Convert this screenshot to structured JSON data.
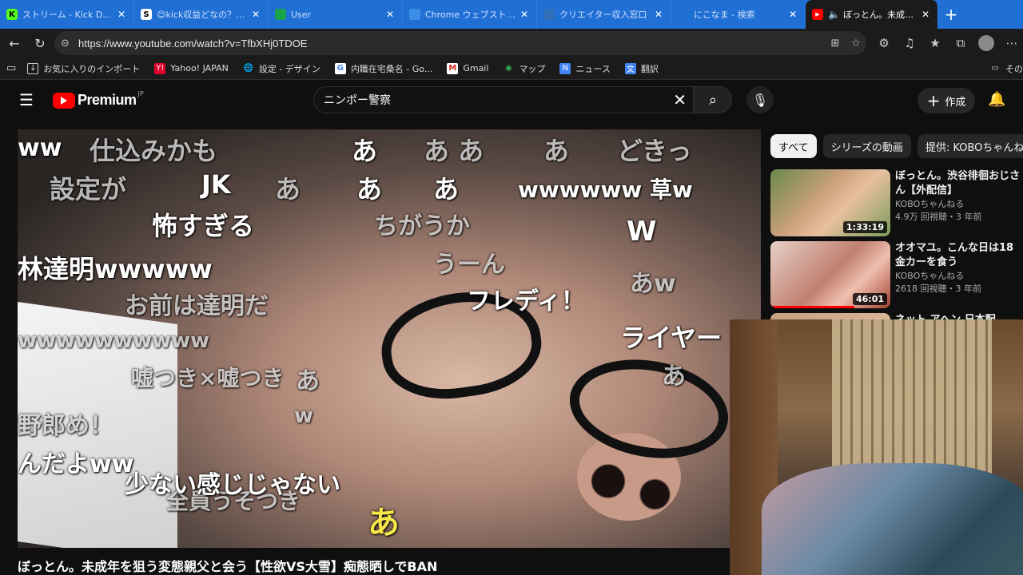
{
  "browser": {
    "tabs": [
      {
        "title": "ストリーム - Kick Dashboard",
        "fav": "K",
        "fav_color": "#53fc18"
      },
      {
        "title": "😊kick収益どなの？😊 AI",
        "fav": "S",
        "fav_color": "#ffffff"
      },
      {
        "title": "User",
        "fav": "",
        "fav_color": "#1aa34a"
      },
      {
        "title": "Chrome ウェブストア - 検索",
        "fav": "",
        "fav_color": "#3a8ee6"
      },
      {
        "title": "クリエイター収入窓口",
        "fav": "",
        "fav_color": "#2f6fb8"
      },
      {
        "title": "にこなま - 検索",
        "fav": "",
        "fav_color": "#1f6fd4"
      },
      {
        "title": "ぼっとん。未成年を狙う",
        "fav": "▶",
        "fav_color": "#ff0000"
      }
    ],
    "url": "https://www.youtube.com/watch?v=TfbXHj0TDOE",
    "bookmarks": [
      {
        "label": "お気に入りのインポート",
        "icon": "import-icon"
      },
      {
        "label": "Yahoo! JAPAN",
        "icon": "yahoo-icon"
      },
      {
        "label": "設定 - デザイン",
        "icon": "globe-icon"
      },
      {
        "label": "内職在宅桑名 - Go...",
        "icon": "google-icon"
      },
      {
        "label": "Gmail",
        "icon": "gmail-icon"
      },
      {
        "label": "マップ",
        "icon": "maps-icon"
      },
      {
        "label": "ニュース",
        "icon": "news-icon"
      },
      {
        "label": "翻訳",
        "icon": "translate-icon"
      }
    ],
    "bookmarks_right": "その他"
  },
  "youtube": {
    "logo_text": "Premium",
    "logo_region": "JP",
    "search_value": "ニンポー警察",
    "create_label": "作成",
    "video_title": "ぼっとん。未成年を狙う変態親父と会う【性欲VS大雪】痴態晒しでBAN",
    "chips": [
      "すべて",
      "シリーズの動画",
      "提供: KOBOちゃんね"
    ],
    "recommendations": [
      {
        "title": "ぼっとん。渋谷徘徊おじさん【外配信】",
        "channel": "KOBOちゃんねる",
        "meta": "4.9万 回視聴・3 年前",
        "duration": "1:33:19"
      },
      {
        "title": "オオマユ。こんな日は18金カーを食う",
        "channel": "KOBOちゃんねる",
        "meta": "2618 回視聴・3 年前",
        "duration": "46:01"
      },
      {
        "title": "ネット アヘン 日本配",
        "channel": "",
        "meta": "",
        "duration": ""
      }
    ]
  },
  "comments": [
    {
      "text": "ww",
      "style": "w"
    },
    {
      "text": "仕込みかも",
      "style": "g"
    },
    {
      "text": "あ",
      "style": "w"
    },
    {
      "text": "あ あ",
      "style": "g"
    },
    {
      "text": "あ",
      "style": "g"
    },
    {
      "text": "どきっ",
      "style": "g"
    },
    {
      "text": "設定が",
      "style": "g"
    },
    {
      "text": "JK",
      "style": "w"
    },
    {
      "text": "あ",
      "style": "g"
    },
    {
      "text": "あ",
      "style": "w"
    },
    {
      "text": "あ",
      "style": "w"
    },
    {
      "text": "wwwwww 草w",
      "style": "w"
    },
    {
      "text": "怖すぎる",
      "style": "w"
    },
    {
      "text": "ちがうか",
      "style": "g"
    },
    {
      "text": "W",
      "style": "w"
    },
    {
      "text": "林達明wwwww",
      "style": "w"
    },
    {
      "text": "うーん",
      "style": "g"
    },
    {
      "text": "あw",
      "style": "g"
    },
    {
      "text": "お前は達明だ",
      "style": "g"
    },
    {
      "text": "フレディ！",
      "style": "w"
    },
    {
      "text": "ライヤー",
      "style": "w"
    },
    {
      "text": "wwwwwwwwww",
      "style": "g"
    },
    {
      "text": "嘘つき×嘘つき",
      "style": "g"
    },
    {
      "text": "あ",
      "style": "g"
    },
    {
      "text": "あ",
      "style": "g"
    },
    {
      "text": "野郎め！",
      "style": "g"
    },
    {
      "text": "w",
      "style": "g"
    },
    {
      "text": "んだよww",
      "style": "w"
    },
    {
      "text": "少ない感じじゃない",
      "style": "w"
    },
    {
      "text": "全員うそつき",
      "style": "g"
    },
    {
      "text": "あ",
      "style": "y"
    }
  ]
}
